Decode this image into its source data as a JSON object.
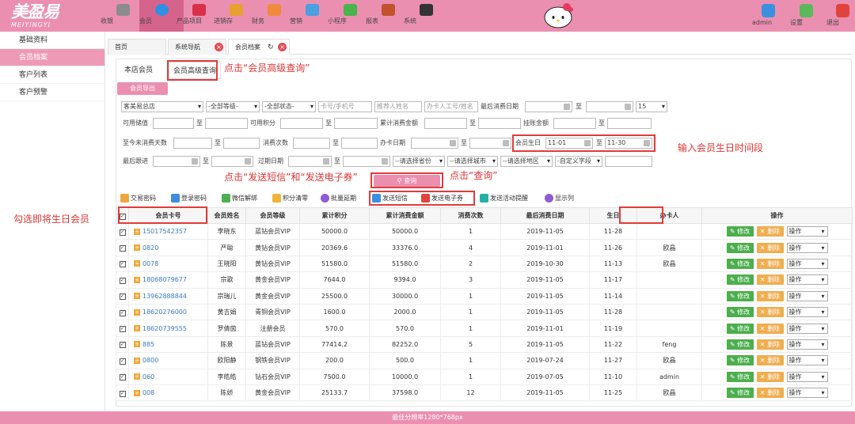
{
  "app": {
    "logo_cn": "美盈易",
    "logo_en": "MEIYINGYI"
  },
  "topnav": [
    {
      "label": "收银",
      "icon": "cashier-icon"
    },
    {
      "label": "会员",
      "icon": "member-icon"
    },
    {
      "label": "产品项目",
      "icon": "product-icon"
    },
    {
      "label": "进销存",
      "icon": "inventory-icon"
    },
    {
      "label": "财务",
      "icon": "finance-icon"
    },
    {
      "label": "营销",
      "icon": "marketing-icon"
    },
    {
      "label": "小程序",
      "icon": "miniprogram-icon"
    },
    {
      "label": "报表",
      "icon": "report-icon"
    },
    {
      "label": "系统",
      "icon": "system-icon"
    }
  ],
  "topright": [
    {
      "label": "admin",
      "icon": "user-icon"
    },
    {
      "label": "设置",
      "icon": "settings-icon"
    },
    {
      "label": "退出",
      "icon": "exit-icon"
    }
  ],
  "sidebar": [
    "基础资料",
    "会员档案",
    "客户列表",
    "客户预警"
  ],
  "tabs": [
    "首页",
    "系统导航",
    "会员档案"
  ],
  "subtabs": [
    "本店会员",
    "会员高级查询"
  ],
  "export_label": "会员导出",
  "filters": {
    "store": "客美易总店",
    "level": "-全部等级-",
    "status": "-全部状态-",
    "card_placeholder": "卡号/手机号",
    "referrer_placeholder": "推荐人姓名",
    "handler_placeholder": "办卡人工号/姓名",
    "last_consume_label": "最后消费日期",
    "to": "至",
    "page_size": "15",
    "available_value": "可用储值",
    "available_points": "可用积分",
    "total_consume": "累计消费金额",
    "credit_amount": "挂账金额",
    "days_no_consume": "至今未消费天数",
    "consume_count": "消费次数",
    "card_date": "办卡日期",
    "birthday_label": "会员生日",
    "birthday_from": "11-01",
    "birthday_to": "11-30",
    "last_followup": "最后跟进",
    "expire_date": "过期日期",
    "province": "--请选择省份",
    "city": "--请选择城市",
    "district": "--请选择地区",
    "custom_field": "-自定义字段",
    "query_label": "查询"
  },
  "toolbar": [
    "交易密码",
    "登录密码",
    "微信解绑",
    "积分清零",
    "批量延期",
    "发送短信",
    "发送电子券",
    "发送活动提醒",
    "显示列"
  ],
  "annotations": {
    "advanced_query": "点击“会员高级查询”",
    "birthday": "输入会员生日时间段",
    "send": "点击“发送短信”和“发送电子券”",
    "query": "点击“查询”",
    "select_all": "勾选即将生日会员"
  },
  "columns": [
    "会员卡号",
    "会员姓名",
    "会员等级",
    "累计积分",
    "累计消费金额",
    "消费次数",
    "最后消费日期",
    "生日",
    "办卡人",
    "操作"
  ],
  "rows": [
    [
      "15017542357",
      "李晓东",
      "蓝钻会员VIP",
      "50000.0",
      "50000.0",
      "1",
      "2019-11-05",
      "11-28",
      ""
    ],
    [
      "0820",
      "严聪",
      "黄钻会员VIP",
      "20369.6",
      "33376.0",
      "4",
      "2019-11-01",
      "11-26",
      "欧晶"
    ],
    [
      "0078",
      "王晓阳",
      "黄钻会员VIP",
      "51580.0",
      "51580.0",
      "2",
      "2019-10-30",
      "11-13",
      "欧晶"
    ],
    [
      "18068079677",
      "宗歌",
      "黄金会员VIP",
      "7644.0",
      "9394.0",
      "3",
      "2019-11-05",
      "11-17",
      ""
    ],
    [
      "13962888844",
      "宗瑞儿",
      "黄金会员VIP",
      "25500.0",
      "30000.0",
      "1",
      "2019-11-05",
      "11-14",
      ""
    ],
    [
      "18620276000",
      "黄吉娟",
      "青铜会员VIP",
      "1600.0",
      "2000.0",
      "1",
      "2019-11-05",
      "11-28",
      ""
    ],
    [
      "18620739555",
      "罗倩茵",
      "注册会员",
      "570.0",
      "570.0",
      "1",
      "2019-11-01",
      "11-19",
      ""
    ],
    [
      "885",
      "陈景",
      "蓝钻会员VIP",
      "77414.2",
      "82252.0",
      "5",
      "2019-11-05",
      "11-22",
      "feng"
    ],
    [
      "0800",
      "欧阳静",
      "钢铁会员VIP",
      "200.0",
      "500.0",
      "1",
      "2019-07-24",
      "11-27",
      "欧晶"
    ],
    [
      "060",
      "李皓皓",
      "钻石会员VIP",
      "7500.0",
      "10000.0",
      "1",
      "2019-07-05",
      "11-10",
      "admin"
    ],
    [
      "008",
      "陈娇",
      "黄金会员VIP",
      "25133.7",
      "37598.0",
      "12",
      "2019-11-05",
      "11-25",
      "欧晶"
    ]
  ],
  "row_actions": {
    "edit": "✎ 修改",
    "delete": "✕ 删除",
    "op": "操作"
  },
  "footer": "最佳分辨率1280*768px",
  "colors": {
    "accent": "#eb8fb0",
    "active": "#d6638c",
    "annotation": "#e03434"
  }
}
